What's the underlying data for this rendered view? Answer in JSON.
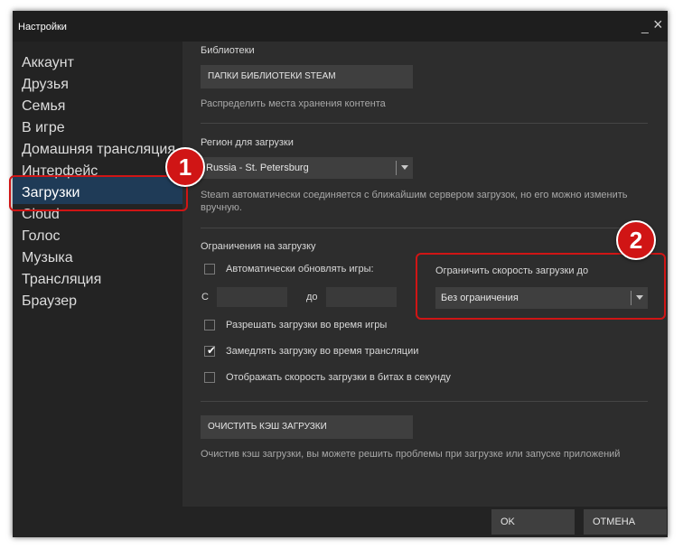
{
  "window": {
    "title": "Настройки",
    "minimize_glyph": "_",
    "close_glyph": "×"
  },
  "sidebar": {
    "items": [
      {
        "label": "Аккаунт"
      },
      {
        "label": "Друзья"
      },
      {
        "label": "Семья"
      },
      {
        "label": "В игре"
      },
      {
        "label": "Домашняя трансляция"
      },
      {
        "label": "Интерфейс"
      },
      {
        "label": "Загрузки",
        "active": true
      },
      {
        "label": "Cloud"
      },
      {
        "label": "Голос"
      },
      {
        "label": "Музыка"
      },
      {
        "label": "Трансляция"
      },
      {
        "label": "Браузер"
      }
    ]
  },
  "libraries": {
    "heading": "Библиотеки",
    "button_label": "ПАПКИ БИБЛИОТЕКИ STEAM",
    "description": "Распределить места хранения контента"
  },
  "region": {
    "heading": "Регион для загрузки",
    "selected": "Russia - St. Petersburg",
    "description_line1": "Steam автоматически соединяется с ближайшим сервером загрузок, но его можно изменить",
    "description_line2": "вручную."
  },
  "limits": {
    "heading": "Ограничения на загрузку",
    "auto_update_label": "Автоматически обновлять игры:",
    "from_label": "С",
    "to_label": "до",
    "allow_during_game_label": "Разрешать загрузки во время игры",
    "throttle_streaming_label": "Замедлять загрузку во время трансляции",
    "show_bits_label": "Отображать скорость загрузки в битах в секунду",
    "checkbox_states": {
      "auto_update": false,
      "allow_during_game": false,
      "throttle_streaming": true,
      "show_bits": false
    },
    "speed_limit_label": "Ограничить скорость загрузки до",
    "speed_limit_value": "Без ограничения"
  },
  "cache": {
    "button_label": "ОЧИСТИТЬ КЭШ ЗАГРУЗКИ",
    "description": "Очистив кэш загрузки, вы можете решить проблемы при загрузке или запуске приложений"
  },
  "footer": {
    "ok_label": "OK",
    "cancel_label": "ОТМЕНА"
  },
  "annotations": {
    "badge1": "1",
    "badge2": "2",
    "color": "#d01515"
  },
  "colors": {
    "active_item": "#1f3b57",
    "window_bg": "#2d2d2d",
    "sidebar_bg": "#232323"
  }
}
